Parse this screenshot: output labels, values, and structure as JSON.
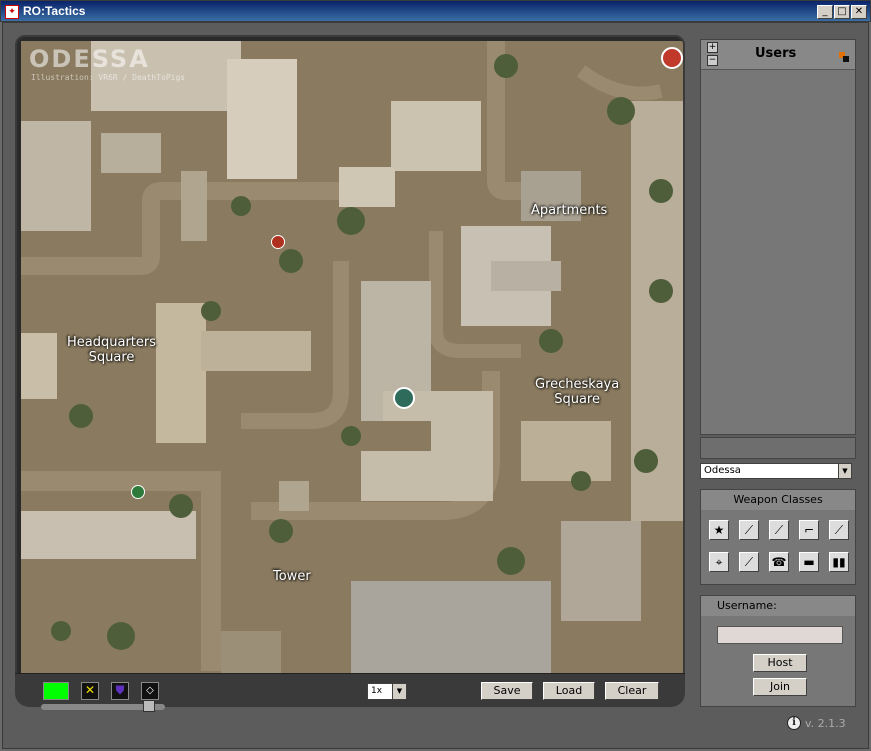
{
  "window": {
    "title": "RO:Tactics",
    "minimize": "_",
    "maximize": "□",
    "close": "✕"
  },
  "map": {
    "brand": "ODESSA",
    "credit": "Illustration: VR6R / DeathToPigs",
    "labels": {
      "apartments": "Apartments",
      "headquarters_line1": "Headquarters",
      "headquarters_line2": "Square",
      "grecheskaya_line1": "Grecheskaya",
      "grecheskaya_line2": "Square",
      "tower": "Tower"
    }
  },
  "toolbar": {
    "zoom": "1x",
    "save": "Save",
    "load": "Load",
    "clear": "Clear",
    "colors": {
      "green": "#00ff00",
      "yellow": "#f0e000",
      "purple": "#6030c0",
      "eraser": "#ffffff"
    }
  },
  "users_panel": {
    "title": "Users",
    "expand": "+",
    "collapse": "−"
  },
  "map_select": {
    "value": "Odessa"
  },
  "weapons": {
    "title": "Weapon Classes",
    "icons": [
      "star-icon",
      "knife-icon",
      "rifle-icon",
      "smg-icon",
      "sniper-icon",
      "crosshair-icon",
      "grenade-icon",
      "radio-icon",
      "tank-icon",
      "binoculars-icon"
    ]
  },
  "login": {
    "username_label": "Username:",
    "username_value": "",
    "host": "Host",
    "join": "Join"
  },
  "version": "v. 2.1.3"
}
